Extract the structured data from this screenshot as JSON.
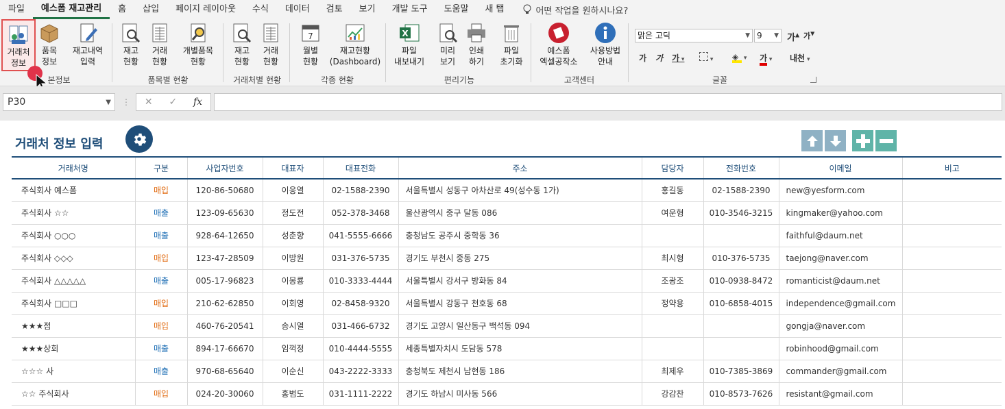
{
  "menu": {
    "tabs": [
      "파일",
      "예스폼 재고관리",
      "홈",
      "삽입",
      "페이지 레이아웃",
      "수식",
      "데이터",
      "검토",
      "보기",
      "개발 도구",
      "도움말",
      "새 탭"
    ],
    "active_index": 1,
    "tell_me": "어떤 작업을 원하시나요?"
  },
  "ribbon": {
    "buttons": {
      "partner_info": "거래처\n정보",
      "item_info": "품목\n정보",
      "stock_entry": "재고내역\n입력",
      "stock_status": "재고\n현황",
      "trade_status": "거래\n현황",
      "item_status": "개별품목\n현황",
      "p_stock_status": "재고\n현황",
      "p_trade_status": "거래\n현황",
      "monthly_status": "월별\n현황",
      "dashboard": "재고현황\n(Dashboard)",
      "export": "파일\n내보내기",
      "preview": "미리\n보기",
      "print": "인쇄\n하기",
      "reset": "파일\n초기화",
      "workshop": "예스폼\n엑셀공작소",
      "guide": "사용방법\n안내"
    },
    "groups": {
      "basic": "본정보",
      "by_item": "품목별 현황",
      "by_partner": "거래처별 현황",
      "various": "각종 현황",
      "convenience": "편리기능",
      "support": "고객센터",
      "font": "글꼴"
    },
    "font_name": "맑은 고딕",
    "font_size": "9",
    "fmt": {
      "grow": "가",
      "shrink": "가",
      "bold": "가",
      "italic": "가",
      "underline": "가",
      "fontcolor": "가",
      "phonetic": "내천"
    }
  },
  "formula_bar": {
    "name_box": "P30",
    "fx": "fx"
  },
  "sheet": {
    "title": "거래처 정보 입력",
    "columns": [
      "거래처명",
      "구분",
      "사업자번호",
      "대표자",
      "대표전화",
      "주소",
      "담당자",
      "전화번호",
      "이메일",
      "비고"
    ],
    "rows": [
      [
        "주식회사 예스폼",
        "매입",
        "120-86-50680",
        "이응열",
        "02-1588-2390",
        "서울특별시 성동구 아차산로 49(성수동 1가)",
        "홍길동",
        "02-1588-2390",
        "new@yesform.com",
        ""
      ],
      [
        "주식회사 ☆☆",
        "매출",
        "123-09-65630",
        "정도전",
        "052-378-3468",
        "울산광역시 중구 달동 086",
        "여운형",
        "010-3546-3215",
        "kingmaker@yahoo.com",
        ""
      ],
      [
        "주식회사 ○○○",
        "매출",
        "928-64-12650",
        "성춘향",
        "041-5555-6666",
        "충청남도 공주시 중학동 36",
        "",
        "",
        "faithful@daum.net",
        ""
      ],
      [
        "주식회사 ◇◇◇",
        "매입",
        "123-47-28509",
        "이방원",
        "031-376-5735",
        "경기도 부천시 중동 275",
        "최시형",
        "010-376-5735",
        "taejong@naver.com",
        ""
      ],
      [
        "주식회사 △△△△△",
        "매출",
        "005-17-96823",
        "이몽룡",
        "010-3333-4444",
        "서울특별시 강서구 방화동 84",
        "조광조",
        "010-0938-8472",
        "romanticist@daum.net",
        ""
      ],
      [
        "주식회사 □□□",
        "매입",
        "210-62-62850",
        "이회영",
        "02-8458-9320",
        "서울특별시 강동구 천호동 68",
        "정약용",
        "010-6858-4015",
        "independence@gmail.com",
        ""
      ],
      [
        "★★★점",
        "매입",
        "460-76-20541",
        "송시열",
        "031-466-6732",
        "경기도 고양시 일산동구 백석동 094",
        "",
        "",
        "gongja@naver.com",
        ""
      ],
      [
        "★★★상회",
        "매출",
        "894-17-66670",
        "임꺽정",
        "010-4444-5555",
        "세종특별자치시 도담동 578",
        "",
        "",
        "robinhood@gmail.com",
        ""
      ],
      [
        "☆☆☆ 사",
        "매출",
        "970-68-65640",
        "이순신",
        "043-2222-3333",
        "충청북도 제천시 남현동 186",
        "최제우",
        "010-7385-3869",
        "commander@gmail.com",
        ""
      ],
      [
        "☆☆ 주식회사",
        "매입",
        "024-20-30060",
        "홍범도",
        "031-1111-2222",
        "경기도 하남시 미사동 566",
        "강감찬",
        "010-8573-7626",
        "resistant@gmail.com",
        ""
      ]
    ],
    "buttons": [
      "move-up",
      "move-down",
      "add-row",
      "delete-row"
    ]
  },
  "colors": {
    "accent": "#1f4e79",
    "excel_green": "#217346",
    "buy": "#e06a10",
    "sell": "#1f6fb5"
  }
}
